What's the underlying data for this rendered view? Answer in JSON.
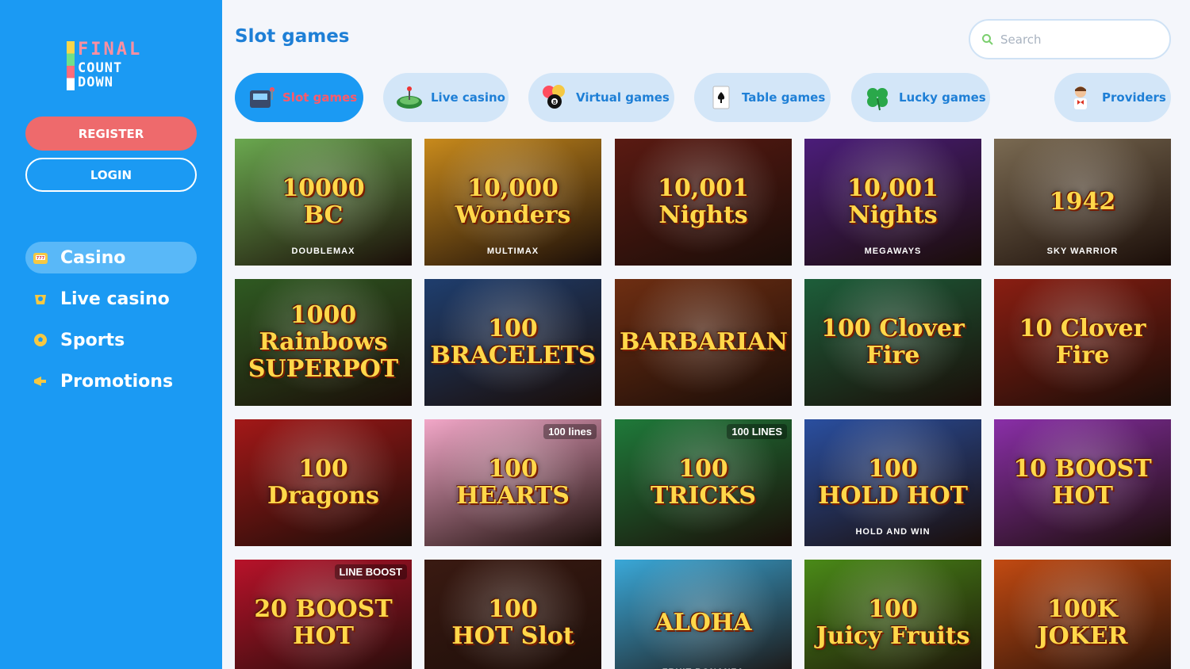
{
  "brand": {
    "logo_lines": [
      "FINAL",
      "COUNT",
      "DOWN"
    ]
  },
  "auth": {
    "register_label": "REGISTER",
    "login_label": "LOGIN"
  },
  "nav": [
    {
      "label": "Casino",
      "icon": "slot-machine-icon",
      "active": true
    },
    {
      "label": "Live casino",
      "icon": "dealer-icon",
      "active": false
    },
    {
      "label": "Sports",
      "icon": "soccer-ball-icon",
      "active": false
    },
    {
      "label": "Promotions",
      "icon": "megaphone-icon",
      "active": false
    }
  ],
  "page": {
    "title": "Slot games"
  },
  "search": {
    "placeholder": "Search",
    "value": ""
  },
  "categories": [
    {
      "label": "Slot games",
      "icon": "slot-machine-icon",
      "active": true
    },
    {
      "label": "Live casino",
      "icon": "roulette-table-icon",
      "active": false
    },
    {
      "label": "Virtual games",
      "icon": "billiard-balls-icon",
      "active": false
    },
    {
      "label": "Table games",
      "icon": "playing-card-icon",
      "active": false
    },
    {
      "label": "Lucky games",
      "icon": "clover-icon",
      "active": false
    },
    {
      "label": "Providers",
      "icon": "host-icon",
      "active": false
    }
  ],
  "games": [
    {
      "title": "10000\nBC",
      "sub": "DOUBLEMAX",
      "badge": "",
      "bg": "#6aa84f"
    },
    {
      "title": "10,000\nWonders",
      "sub": "MULTIMAX",
      "badge": "",
      "bg": "#c88a1c"
    },
    {
      "title": "10,001\nNights",
      "sub": "",
      "badge": "",
      "bg": "#5a1a12"
    },
    {
      "title": "10,001 Nights",
      "sub": "MEGAWAYS",
      "badge": "",
      "bg": "#4b1d7a"
    },
    {
      "title": "1942",
      "sub": "SKY WARRIOR",
      "badge": "",
      "bg": "#7a6a52"
    },
    {
      "title": "1000 Rainbows\nSUPERPOT",
      "sub": "",
      "badge": "",
      "bg": "#2f5a22"
    },
    {
      "title": "100\nBRACELETS",
      "sub": "",
      "badge": "",
      "bg": "#1f3e6e"
    },
    {
      "title": "BARBARIAN",
      "sub": "",
      "badge": "",
      "bg": "#6e2e12"
    },
    {
      "title": "100 Clover Fire",
      "sub": "",
      "badge": "",
      "bg": "#1d5e3a"
    },
    {
      "title": "10 Clover\nFire",
      "sub": "",
      "badge": "",
      "bg": "#8a1e12"
    },
    {
      "title": "100 Dragons",
      "sub": "",
      "badge": "",
      "bg": "#a31818"
    },
    {
      "title": "100\nHEARTS",
      "sub": "",
      "badge": "100 lines",
      "bg": "#f2a7c8"
    },
    {
      "title": "100\nTRICKS",
      "sub": "",
      "badge": "100 LINES",
      "bg": "#1f7a3a"
    },
    {
      "title": "100\nHOLD HOT",
      "sub": "HOLD AND WIN",
      "badge": "",
      "bg": "#2a4fa0"
    },
    {
      "title": "10 BOOST HOT",
      "sub": "",
      "badge": "",
      "bg": "#8a2fa8"
    },
    {
      "title": "20 BOOST HOT",
      "sub": "",
      "badge": "LINE BOOST",
      "bg": "#b8122a"
    },
    {
      "title": "100\nHOT Slot",
      "sub": "",
      "badge": "",
      "bg": "#3a1a12"
    },
    {
      "title": "ALOHA",
      "sub": "FRUIT BONANZA",
      "badge": "",
      "bg": "#3aa8d8"
    },
    {
      "title": "100\nJuicy Fruits",
      "sub": "",
      "badge": "",
      "bg": "#4a8a18"
    },
    {
      "title": "100K\nJOKER",
      "sub": "",
      "badge": "",
      "bg": "#c24a12"
    }
  ]
}
